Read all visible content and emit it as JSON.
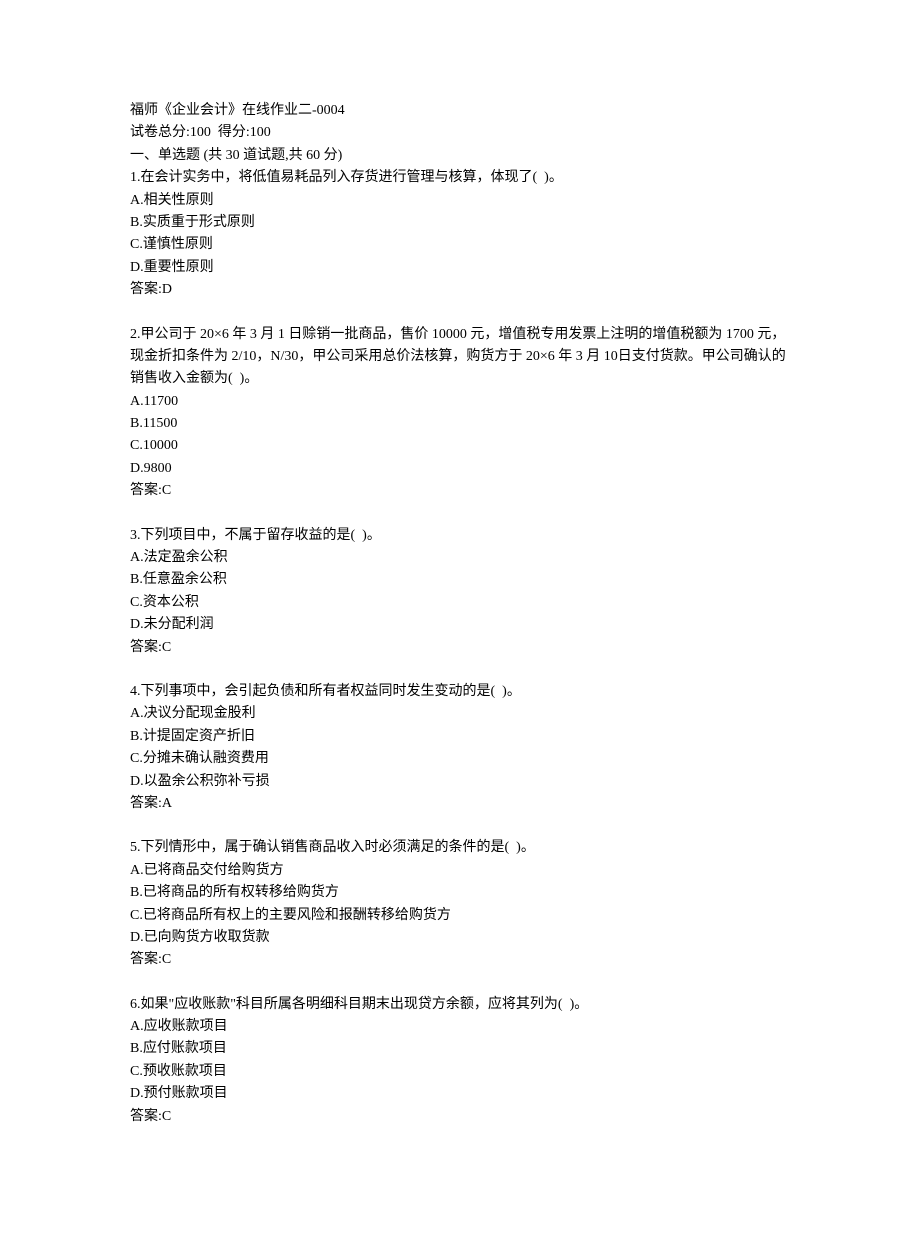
{
  "header": {
    "title": "福师《企业会计》在线作业二-0004",
    "score_line": "试卷总分:100  得分:100",
    "section_title": "一、单选题 (共 30 道试题,共 60 分)"
  },
  "questions": [
    {
      "stem": "1.在会计实务中，将低值易耗品列入存货进行管理与核算，体现了(  )。",
      "options": [
        "A.相关性原则",
        "B.实质重于形式原则",
        "C.谨慎性原则",
        "D.重要性原则"
      ],
      "answer": "答案:D"
    },
    {
      "stem": "2.甲公司于 20×6 年 3 月 1 日赊销一批商品，售价 10000 元，增值税专用发票上注明的增值税额为 1700 元，现金折扣条件为 2/10，N/30，甲公司采用总价法核算，购货方于 20×6 年 3 月 10日支付货款。甲公司确认的销售收入金额为(  )。",
      "options": [
        "A.11700",
        "B.11500",
        "C.10000",
        "D.9800"
      ],
      "answer": "答案:C"
    },
    {
      "stem": "3.下列项目中，不属于留存收益的是(  )。",
      "options": [
        "A.法定盈余公积",
        "B.任意盈余公积",
        "C.资本公积",
        "D.未分配利润"
      ],
      "answer": "答案:C"
    },
    {
      "stem": "4.下列事项中，会引起负债和所有者权益同时发生变动的是(  )。",
      "options": [
        "A.决议分配现金股利",
        "B.计提固定资产折旧",
        "C.分摊未确认融资费用",
        "D.以盈余公积弥补亏损"
      ],
      "answer": "答案:A"
    },
    {
      "stem": "5.下列情形中，属于确认销售商品收入时必须满足的条件的是(  )。",
      "options": [
        "A.已将商品交付给购货方",
        "B.已将商品的所有权转移给购货方",
        "C.已将商品所有权上的主要风险和报酬转移给购货方",
        "D.已向购货方收取货款"
      ],
      "answer": "答案:C"
    },
    {
      "stem": "6.如果\"应收账款\"科目所属各明细科目期末出现贷方余额，应将其列为(  )。",
      "options": [
        "A.应收账款项目",
        "B.应付账款项目",
        "C.预收账款项目",
        "D.预付账款项目"
      ],
      "answer": "答案:C"
    }
  ]
}
